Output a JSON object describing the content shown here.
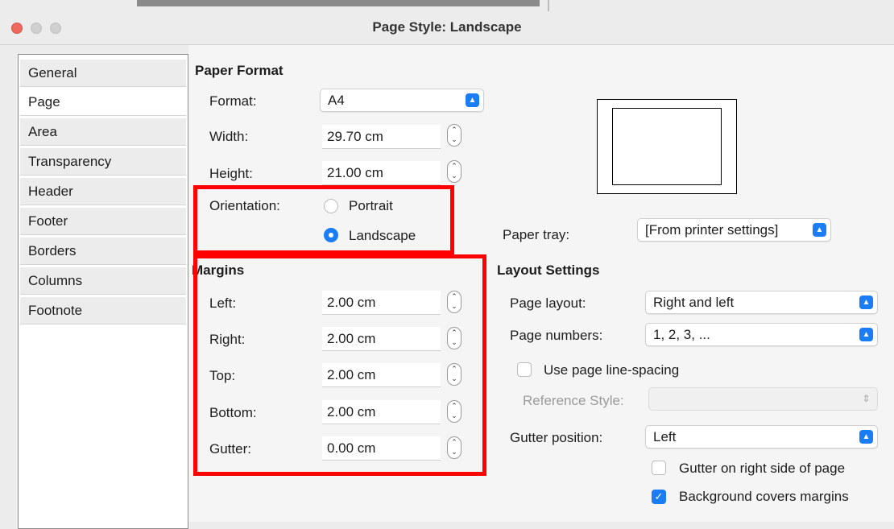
{
  "window": {
    "title": "Page Style: Landscape"
  },
  "sidebar": {
    "items": [
      {
        "label": "General"
      },
      {
        "label": "Page"
      },
      {
        "label": "Area"
      },
      {
        "label": "Transparency"
      },
      {
        "label": "Header"
      },
      {
        "label": "Footer"
      },
      {
        "label": "Borders"
      },
      {
        "label": "Columns"
      },
      {
        "label": "Footnote"
      }
    ],
    "selected": "Page"
  },
  "paper_format": {
    "heading": "Paper Format",
    "format_label": "Format:",
    "format_value": "A4",
    "width_label": "Width:",
    "width_value": "29.70 cm",
    "height_label": "Height:",
    "height_value": "21.00 cm",
    "orientation_label": "Orientation:",
    "portrait_label": "Portrait",
    "landscape_label": "Landscape",
    "orientation_selected": "Landscape",
    "paper_tray_label": "Paper tray:",
    "paper_tray_value": "[From printer settings]"
  },
  "margins": {
    "heading": "Margins",
    "left_label": "Left:",
    "left_value": "2.00 cm",
    "right_label": "Right:",
    "right_value": "2.00 cm",
    "top_label": "Top:",
    "top_value": "2.00 cm",
    "bottom_label": "Bottom:",
    "bottom_value": "2.00 cm",
    "gutter_label": "Gutter:",
    "gutter_value": "0.00 cm"
  },
  "layout": {
    "heading": "Layout Settings",
    "page_layout_label": "Page layout:",
    "page_layout_value": "Right and left",
    "page_numbers_label": "Page numbers:",
    "page_numbers_value": "1, 2, 3, ...",
    "line_spacing_label": "Use page line-spacing",
    "line_spacing_checked": false,
    "reference_style_label": "Reference Style:",
    "reference_style_value": "",
    "gutter_position_label": "Gutter position:",
    "gutter_position_value": "Left",
    "gutter_right_label": "Gutter on right side of page",
    "gutter_right_checked": false,
    "background_label": "Background covers margins",
    "background_checked": true
  },
  "colors": {
    "accent": "#1a7df5",
    "highlight": "#ff0000"
  }
}
